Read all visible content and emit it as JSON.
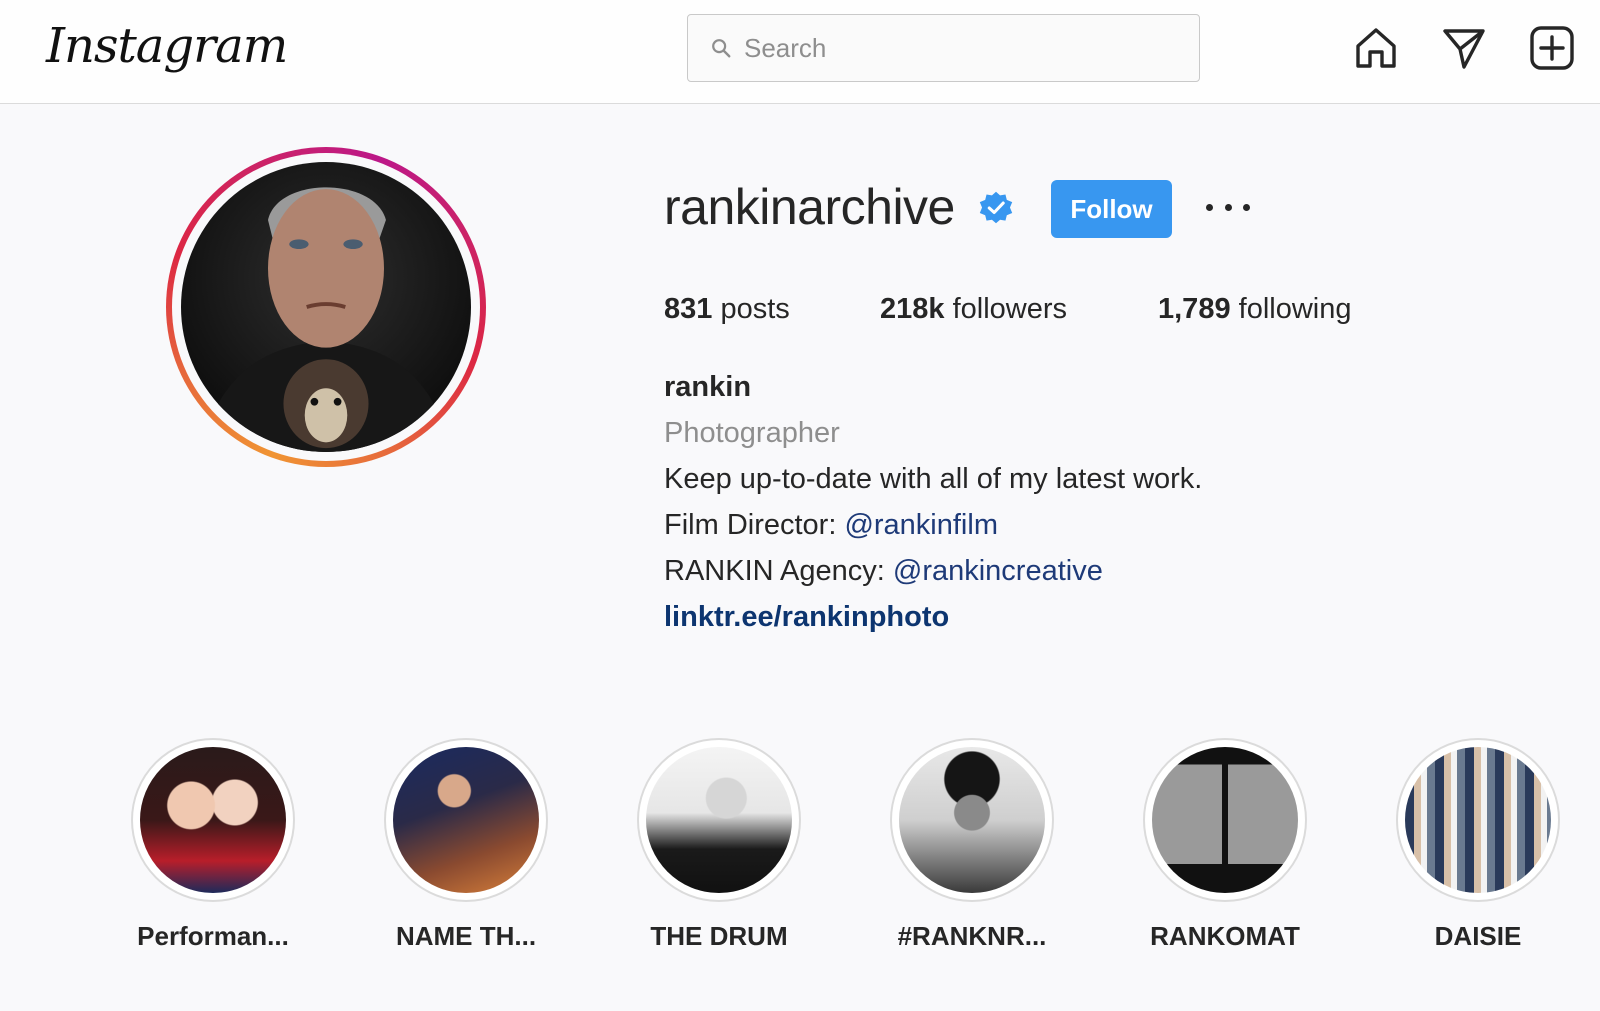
{
  "header": {
    "logo": "Instagram",
    "search_placeholder": "Search",
    "icons": [
      "home-icon",
      "direct-message-icon",
      "new-post-icon"
    ]
  },
  "profile": {
    "username": "rankinarchive",
    "verified": true,
    "follow_label": "Follow",
    "posts_count": "831",
    "posts_label": "posts",
    "followers_count": "218k",
    "followers_label": "followers",
    "following_count": "1,789",
    "following_label": "following",
    "display_name": "rankin",
    "category": "Photographer",
    "bio": "Keep up-to-date with all of my latest work.",
    "film_director_label": "Film Director: ",
    "film_director_handle": "@rankinfilm",
    "agency_label": "RANKIN Agency: ",
    "agency_handle": "@rankincreative",
    "link": "linktr.ee/rankinphoto"
  },
  "highlights": [
    {
      "label": "Performan..."
    },
    {
      "label": "NAME TH..."
    },
    {
      "label": "THE DRUM"
    },
    {
      "label": "#RANKNR..."
    },
    {
      "label": "RANKOMAT"
    },
    {
      "label": "DAISIE"
    }
  ],
  "colors": {
    "follow_button": "#3897f0",
    "verified_badge": "#3897f0",
    "mention": "#1e3a78",
    "link": "#0d3570",
    "muted": "#8e8e8e"
  }
}
